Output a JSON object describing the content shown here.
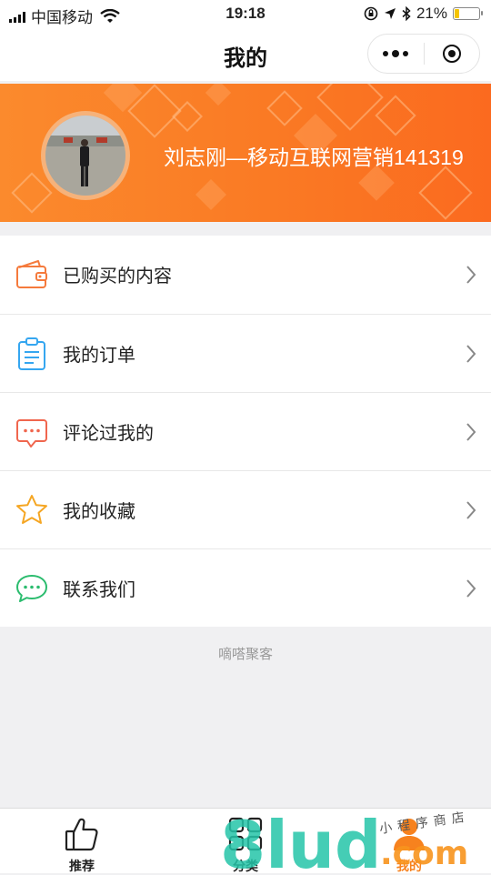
{
  "status_bar": {
    "carrier": "中国移动",
    "time": "19:18",
    "battery_percent": "21%",
    "battery_level": 0.21,
    "icons": [
      "signal-icon",
      "wifi-icon",
      "orientation-lock-icon",
      "location-icon",
      "bluetooth-icon",
      "battery-icon"
    ]
  },
  "nav": {
    "title": "我的",
    "capsule_icons": [
      "more-icon",
      "close-miniprogram-icon"
    ]
  },
  "profile": {
    "username": "刘志刚—移动互联网营销141319",
    "avatar_icon": "avatar-photo"
  },
  "menu": {
    "items": [
      {
        "label": "已购买的内容",
        "icon": "wallet-icon",
        "color": "#f57a3c"
      },
      {
        "label": "我的订单",
        "icon": "clipboard-icon",
        "color": "#35a6f0"
      },
      {
        "label": "评论过我的",
        "icon": "comment-icon",
        "color": "#f0664e"
      },
      {
        "label": "我的收藏",
        "icon": "star-icon",
        "color": "#f5a623"
      },
      {
        "label": "联系我们",
        "icon": "chat-icon",
        "color": "#2bbc6e"
      }
    ]
  },
  "footer": {
    "text": "嘀嗒聚客"
  },
  "tabbar": {
    "tabs": [
      {
        "label": "推荐",
        "icon": "thumbs-up-icon",
        "active": false
      },
      {
        "label": "分类",
        "icon": "grid-icon",
        "active": false
      },
      {
        "label": "我的",
        "icon": "user-icon",
        "active": true
      }
    ]
  },
  "watermark": {
    "brand": "8lud",
    "suffix": ".com",
    "tagline": "小程序商店"
  },
  "colors": {
    "accent": "#f7821e",
    "banner": "#fa7a24",
    "background": "#f0f0f2"
  }
}
